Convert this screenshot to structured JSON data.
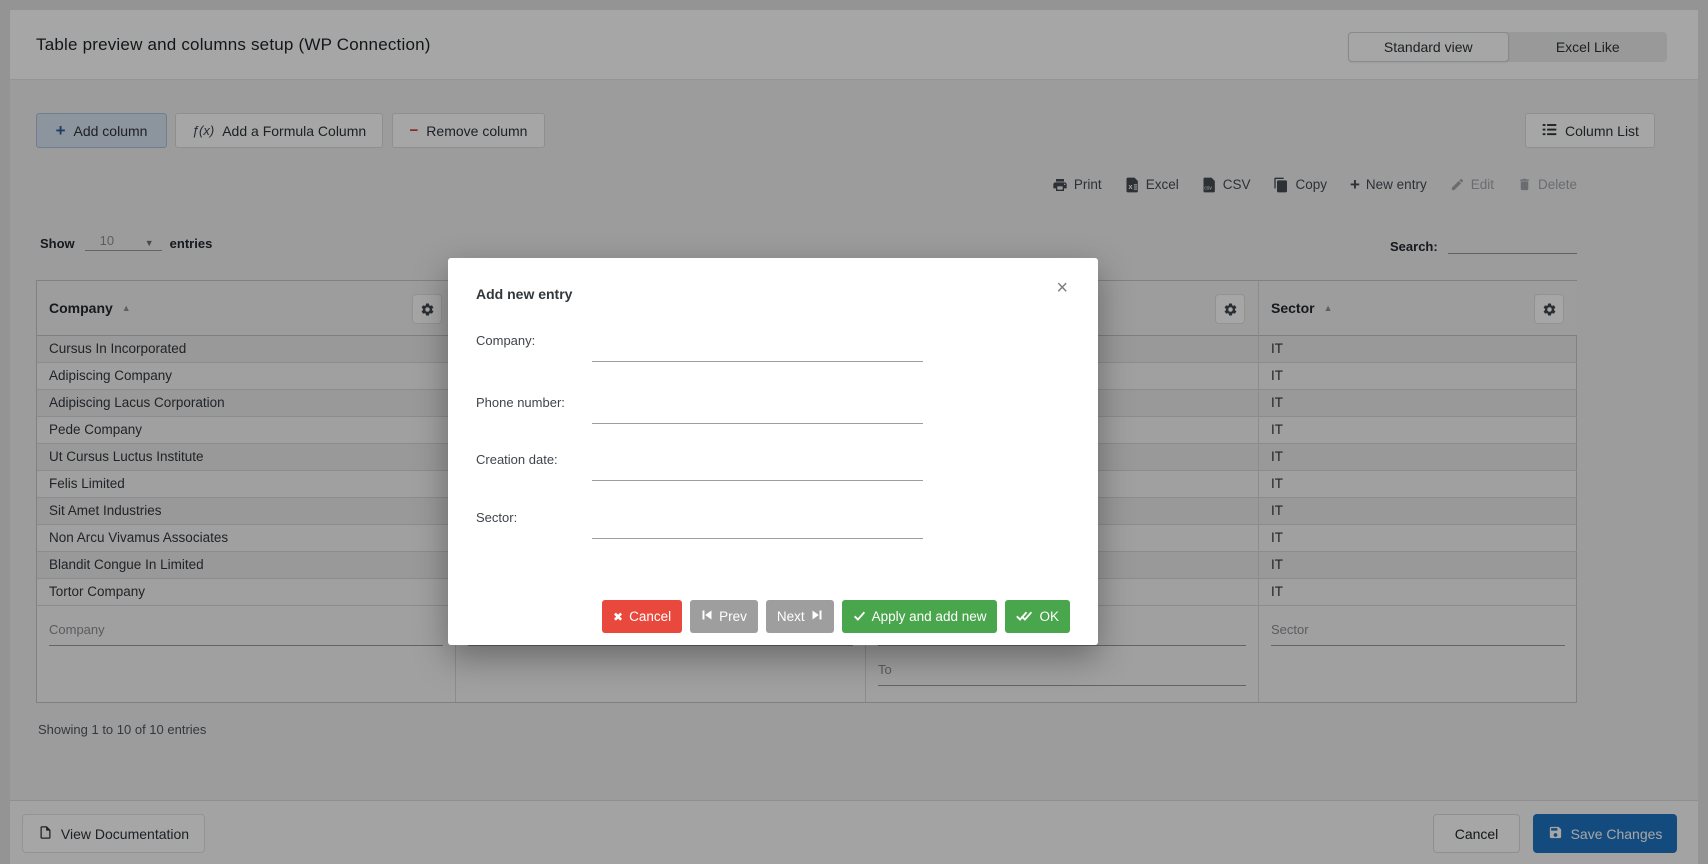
{
  "header": {
    "title": "Table preview and columns setup (WP Connection)",
    "tabs": [
      {
        "label": "Standard view",
        "active": true
      },
      {
        "label": "Excel Like",
        "active": false
      }
    ]
  },
  "toolbar": {
    "add_column": "Add column",
    "add_formula_column": "Add a Formula Column",
    "remove_column": "Remove column",
    "column_list": "Column List"
  },
  "export_bar": {
    "print": "Print",
    "excel": "Excel",
    "csv": "CSV",
    "copy": "Copy",
    "new_entry": "New entry",
    "edit": "Edit",
    "delete": "Delete"
  },
  "controls": {
    "show_label": "Show",
    "page_size": "10",
    "entries_label": "entries",
    "search_label": "Search:"
  },
  "table": {
    "columns": [
      {
        "title": "Company"
      },
      {
        "title": ""
      },
      {
        "title": ""
      },
      {
        "title": "Sector"
      }
    ],
    "rows": [
      [
        "Cursus In Incorporated",
        "",
        "",
        "IT"
      ],
      [
        "Adipiscing Company",
        "",
        "",
        "IT"
      ],
      [
        "Adipiscing Lacus Corporation",
        "",
        "",
        "IT"
      ],
      [
        "Pede Company",
        "",
        "",
        "IT"
      ],
      [
        "Ut Cursus Luctus Institute",
        "",
        "",
        "IT"
      ],
      [
        "Felis Limited",
        "",
        "",
        "IT"
      ],
      [
        "Sit Amet Industries",
        "",
        "",
        "IT"
      ],
      [
        "Non Arcu Vivamus Associates",
        "",
        "",
        "IT"
      ],
      [
        "Blandit Congue In Limited",
        "",
        "",
        "IT"
      ],
      [
        "Tortor Company",
        "",
        "",
        "IT"
      ]
    ],
    "filters": {
      "company_placeholder": "Company",
      "col2_placeholder": "",
      "from_placeholder": "",
      "to_placeholder": "To",
      "sector_placeholder": "Sector"
    },
    "summary": "Showing 1 to 10 of 10 entries"
  },
  "footer": {
    "view_documentation": "View Documentation",
    "cancel": "Cancel",
    "save": "Save Changes"
  },
  "modal": {
    "title": "Add new entry",
    "fields": [
      {
        "label": "Company:"
      },
      {
        "label": "Phone number:"
      },
      {
        "label": "Creation date:"
      },
      {
        "label": "Sector:"
      }
    ],
    "buttons": {
      "cancel": "Cancel",
      "prev": "Prev",
      "next": "Next",
      "apply": "Apply and add new",
      "ok": "OK"
    }
  },
  "icons": {
    "sort_asc": "▲",
    "dropdown": "▼",
    "close": "×",
    "add_plus": "+",
    "new_entry_plus": "+",
    "remove_minus": "−",
    "fx": "ƒ(x)",
    "cancel_x": "✖"
  },
  "colors": {
    "save_blue": "#2073c4",
    "modal_red": "#e8493c",
    "modal_green": "#4aa64d",
    "modal_gray": "#9e9e9e",
    "accent_blue": "#2e5c9a",
    "remove_red": "#d63638"
  }
}
